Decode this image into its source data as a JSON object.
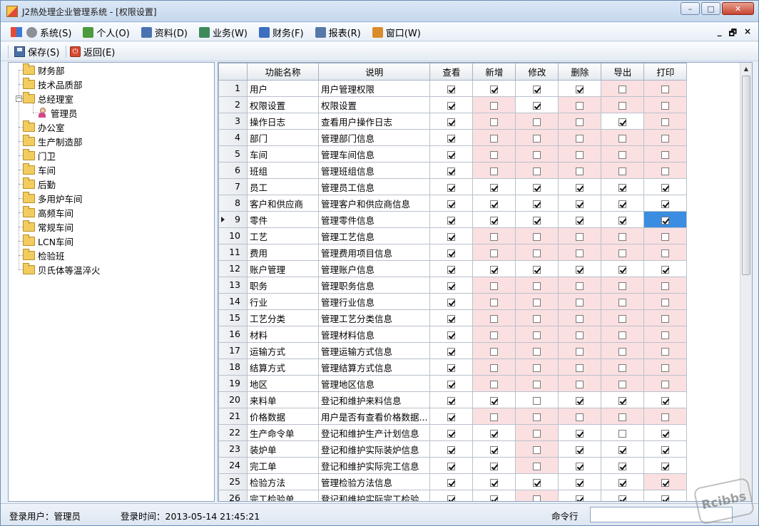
{
  "window": {
    "title": "J2热处理企业管理系统 - [权限设置]",
    "controls": [
      "–",
      "□",
      "✕"
    ]
  },
  "menu": {
    "items": [
      {
        "label": "系统(S)",
        "icon": "gear-icon"
      },
      {
        "label": "个人(O)",
        "icon": "user-icon"
      },
      {
        "label": "资料(D)",
        "icon": "card-icon"
      },
      {
        "label": "业务(W)",
        "icon": "business-icon"
      },
      {
        "label": "财务(F)",
        "icon": "finance-icon"
      },
      {
        "label": "报表(R)",
        "icon": "report-icon"
      },
      {
        "label": "窗口(W)",
        "icon": "window-icon"
      }
    ],
    "mdi_controls": [
      "_",
      "🗗",
      "×"
    ]
  },
  "toolbar": {
    "save_label": "保存(S)",
    "back_label": "返回(E)",
    "back_icon_glyph": "⏻"
  },
  "tree": {
    "nodes": [
      {
        "label": "财务部",
        "level": 0,
        "icon": "folder-icon"
      },
      {
        "label": "技术品质部",
        "level": 0,
        "icon": "folder-icon"
      },
      {
        "label": "总经理室",
        "level": 0,
        "icon": "folder-icon",
        "expanded": true,
        "expander": "−"
      },
      {
        "label": "管理员",
        "level": 1,
        "icon": "user-icon"
      },
      {
        "label": "办公室",
        "level": 0,
        "icon": "folder-icon"
      },
      {
        "label": "生产制造部",
        "level": 0,
        "icon": "folder-icon"
      },
      {
        "label": "门卫",
        "level": 0,
        "icon": "folder-icon"
      },
      {
        "label": "车间",
        "level": 0,
        "icon": "folder-icon"
      },
      {
        "label": "后勤",
        "level": 0,
        "icon": "folder-icon"
      },
      {
        "label": "多用炉车间",
        "level": 0,
        "icon": "folder-icon"
      },
      {
        "label": "高频车间",
        "level": 0,
        "icon": "folder-icon"
      },
      {
        "label": "常规车间",
        "level": 0,
        "icon": "folder-icon"
      },
      {
        "label": "LCN车间",
        "level": 0,
        "icon": "folder-icon"
      },
      {
        "label": "检验班",
        "level": 0,
        "icon": "folder-icon"
      },
      {
        "label": "贝氏体等温淬火",
        "level": 0,
        "icon": "folder-icon"
      }
    ]
  },
  "grid": {
    "columns": [
      "功能名称",
      "说明",
      "查看",
      "新增",
      "修改",
      "删除",
      "导出",
      "打印"
    ],
    "current_row": 9,
    "selected_cell": {
      "row": 9,
      "col": 5
    },
    "rows": [
      {
        "no": "1",
        "name": "用户",
        "desc": "用户管理权限",
        "perms": [
          1,
          1,
          1,
          1,
          0,
          0
        ],
        "enabled": [
          1,
          1,
          1,
          1,
          0,
          0
        ]
      },
      {
        "no": "2",
        "name": "权限设置",
        "desc": "权限设置",
        "perms": [
          1,
          0,
          1,
          0,
          0,
          0
        ],
        "enabled": [
          1,
          0,
          1,
          0,
          0,
          0
        ]
      },
      {
        "no": "3",
        "name": "操作日志",
        "desc": "查看用户操作日志",
        "perms": [
          1,
          0,
          0,
          0,
          1,
          0
        ],
        "enabled": [
          1,
          0,
          0,
          0,
          1,
          0
        ]
      },
      {
        "no": "4",
        "name": "部门",
        "desc": "管理部门信息",
        "perms": [
          1,
          0,
          0,
          0,
          0,
          0
        ],
        "enabled": [
          1,
          0,
          0,
          0,
          0,
          0
        ]
      },
      {
        "no": "5",
        "name": "车间",
        "desc": "管理车间信息",
        "perms": [
          1,
          0,
          0,
          0,
          0,
          0
        ],
        "enabled": [
          1,
          0,
          0,
          0,
          0,
          0
        ]
      },
      {
        "no": "6",
        "name": "班组",
        "desc": "管理班组信息",
        "perms": [
          1,
          0,
          0,
          0,
          0,
          0
        ],
        "enabled": [
          1,
          0,
          0,
          0,
          0,
          0
        ]
      },
      {
        "no": "7",
        "name": "员工",
        "desc": "管理员工信息",
        "perms": [
          1,
          1,
          1,
          1,
          1,
          1
        ],
        "enabled": [
          1,
          1,
          1,
          1,
          1,
          1
        ]
      },
      {
        "no": "8",
        "name": "客户和供应商",
        "desc": "管理客户和供应商信息",
        "perms": [
          1,
          1,
          1,
          1,
          1,
          1
        ],
        "enabled": [
          1,
          1,
          1,
          1,
          1,
          1
        ]
      },
      {
        "no": "9",
        "name": "零件",
        "desc": "管理零件信息",
        "perms": [
          1,
          1,
          1,
          1,
          1,
          1
        ],
        "enabled": [
          1,
          1,
          1,
          1,
          1,
          1
        ]
      },
      {
        "no": "10",
        "name": "工艺",
        "desc": "管理工艺信息",
        "perms": [
          1,
          0,
          0,
          0,
          0,
          0
        ],
        "enabled": [
          1,
          0,
          0,
          0,
          0,
          0
        ]
      },
      {
        "no": "11",
        "name": "费用",
        "desc": "管理费用项目信息",
        "perms": [
          1,
          0,
          0,
          0,
          0,
          0
        ],
        "enabled": [
          1,
          0,
          0,
          0,
          0,
          0
        ]
      },
      {
        "no": "12",
        "name": "账户管理",
        "desc": "管理账户信息",
        "perms": [
          1,
          1,
          1,
          1,
          1,
          1
        ],
        "enabled": [
          1,
          1,
          1,
          1,
          1,
          1
        ]
      },
      {
        "no": "13",
        "name": "职务",
        "desc": "管理职务信息",
        "perms": [
          1,
          0,
          0,
          0,
          0,
          0
        ],
        "enabled": [
          1,
          0,
          0,
          0,
          0,
          0
        ]
      },
      {
        "no": "14",
        "name": "行业",
        "desc": "管理行业信息",
        "perms": [
          1,
          0,
          0,
          0,
          0,
          0
        ],
        "enabled": [
          1,
          0,
          0,
          0,
          0,
          0
        ]
      },
      {
        "no": "15",
        "name": "工艺分类",
        "desc": "管理工艺分类信息",
        "perms": [
          1,
          0,
          0,
          0,
          0,
          0
        ],
        "enabled": [
          1,
          0,
          0,
          0,
          0,
          0
        ]
      },
      {
        "no": "16",
        "name": "材料",
        "desc": "管理材料信息",
        "perms": [
          1,
          0,
          0,
          0,
          0,
          0
        ],
        "enabled": [
          1,
          0,
          0,
          0,
          0,
          0
        ]
      },
      {
        "no": "17",
        "name": "运输方式",
        "desc": "管理运输方式信息",
        "perms": [
          1,
          0,
          0,
          0,
          0,
          0
        ],
        "enabled": [
          1,
          0,
          0,
          0,
          0,
          0
        ]
      },
      {
        "no": "18",
        "name": "结算方式",
        "desc": "管理结算方式信息",
        "perms": [
          1,
          0,
          0,
          0,
          0,
          0
        ],
        "enabled": [
          1,
          0,
          0,
          0,
          0,
          0
        ]
      },
      {
        "no": "19",
        "name": "地区",
        "desc": "管理地区信息",
        "perms": [
          1,
          0,
          0,
          0,
          0,
          0
        ],
        "enabled": [
          1,
          0,
          0,
          0,
          0,
          0
        ]
      },
      {
        "no": "20",
        "name": "来料单",
        "desc": "登记和维护来料信息",
        "perms": [
          1,
          1,
          0,
          1,
          1,
          1
        ],
        "enabled": [
          1,
          1,
          1,
          1,
          1,
          1
        ]
      },
      {
        "no": "21",
        "name": "价格数据",
        "desc": "用户是否有查看价格数据...",
        "perms": [
          1,
          0,
          0,
          0,
          0,
          0
        ],
        "enabled": [
          1,
          0,
          0,
          0,
          0,
          0
        ]
      },
      {
        "no": "22",
        "name": "生产命令单",
        "desc": "登记和维护生产计划信息",
        "perms": [
          1,
          1,
          0,
          1,
          0,
          1
        ],
        "enabled": [
          1,
          1,
          0,
          1,
          1,
          1
        ]
      },
      {
        "no": "23",
        "name": "装炉单",
        "desc": "登记和维护实际装炉信息",
        "perms": [
          1,
          1,
          0,
          1,
          1,
          1
        ],
        "enabled": [
          1,
          1,
          0,
          1,
          1,
          1
        ]
      },
      {
        "no": "24",
        "name": "完工单",
        "desc": "登记和维护实际完工信息",
        "perms": [
          1,
          1,
          0,
          1,
          1,
          1
        ],
        "enabled": [
          1,
          1,
          0,
          1,
          1,
          1
        ]
      },
      {
        "no": "25",
        "name": "检验方法",
        "desc": "管理检验方法信息",
        "perms": [
          1,
          1,
          1,
          1,
          1,
          1
        ],
        "enabled": [
          1,
          1,
          1,
          1,
          1,
          0
        ]
      },
      {
        "no": "26",
        "name": "完工检验单",
        "desc": "登记和维护实际完工检验...",
        "perms": [
          1,
          1,
          0,
          1,
          1,
          1
        ],
        "enabled": [
          1,
          1,
          0,
          1,
          1,
          1
        ]
      }
    ]
  },
  "status": {
    "login_user": "登录用户：管理员",
    "login_time": "登录时间：2013-05-14 21:45:21",
    "command_label": "命令行",
    "command_value": ""
  },
  "watermark": "Rcibbs",
  "colors": {
    "disabled_cell": "#fbe0e1",
    "selected_cell": "#3a8de0",
    "titlebar": "#c6d8ee"
  }
}
